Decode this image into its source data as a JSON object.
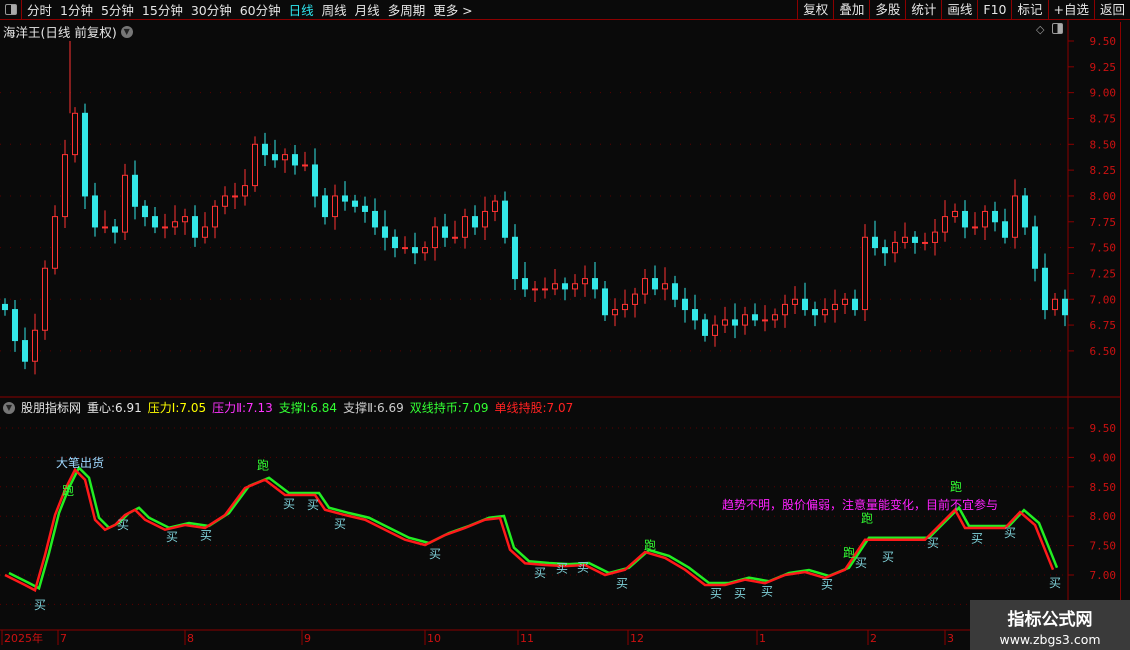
{
  "toolbar": {
    "tabs": [
      "分时",
      "1分钟",
      "5分钟",
      "15分钟",
      "30分钟",
      "60分钟",
      "日线",
      "周线",
      "月线",
      "多周期",
      "更多 >"
    ],
    "active_tab": "日线",
    "right_buttons": [
      "复权",
      "叠加",
      "多股",
      "统计",
      "画线",
      "F10",
      "标记",
      "+自选",
      "返回"
    ]
  },
  "main_chart": {
    "title": "海洋王(日线 前复权)",
    "y_ticks": [
      "9.50",
      "9.25",
      "9.00",
      "8.75",
      "8.50",
      "8.25",
      "8.00",
      "7.75",
      "7.50",
      "7.25",
      "7.00",
      "6.75",
      "6.50"
    ]
  },
  "indicator": {
    "name": "股朋指标网",
    "items": [
      {
        "label": "重心:",
        "value": "6.91",
        "color": "#e6e6e6"
      },
      {
        "label": "压力Ⅰ:",
        "value": "7.05",
        "color": "#ffff00"
      },
      {
        "label": "压力Ⅱ:",
        "value": "7.13",
        "color": "#ff33ff"
      },
      {
        "label": "支撑Ⅰ:",
        "value": "6.84",
        "color": "#33ff33"
      },
      {
        "label": "支撑Ⅱ:",
        "value": "6.69",
        "color": "#cccccc"
      },
      {
        "label": "双线持币:",
        "value": "7.09",
        "color": "#33ff33"
      },
      {
        "label": "单线持股:",
        "value": "7.07",
        "color": "#ff2222"
      }
    ],
    "y_ticks": [
      "9.50",
      "9.00",
      "8.50",
      "8.00",
      "7.50",
      "7.00"
    ],
    "note": "趋势不明，股价偏弱，注意量能变化，目前不宜参与",
    "big_sell": "大笔出货",
    "buy": "买",
    "run": "跑"
  },
  "date_axis": [
    "2025年",
    "7",
    "8",
    "9",
    "10",
    "11",
    "12",
    "1",
    "2",
    "3"
  ],
  "watermark": {
    "name": "指标公式网",
    "url": "www.zbgs3.com"
  },
  "colors": {
    "up": "#ff3333",
    "down": "#33e6e6",
    "line_red": "#ff1a1a",
    "line_green": "#22ee22",
    "grid": "#8b0000",
    "axis_text": "#cc1111"
  },
  "chart_data": [
    {
      "type": "candlestick",
      "title": "海洋王(日线 前复权)",
      "ylim": [
        6.3,
        9.6
      ],
      "close": [
        6.9,
        6.6,
        6.4,
        6.7,
        7.3,
        7.8,
        8.4,
        8.8,
        8.0,
        7.7,
        7.7,
        7.65,
        8.2,
        7.9,
        7.8,
        7.7,
        7.7,
        7.75,
        7.8,
        7.6,
        7.7,
        7.9,
        8.0,
        8.0,
        8.1,
        8.5,
        8.4,
        8.35,
        8.4,
        8.3,
        8.3,
        8.0,
        7.8,
        8.0,
        7.95,
        7.9,
        7.85,
        7.7,
        7.6,
        7.5,
        7.5,
        7.45,
        7.5,
        7.7,
        7.6,
        7.6,
        7.8,
        7.7,
        7.85,
        7.95,
        7.6,
        7.2,
        7.1,
        7.1,
        7.1,
        7.15,
        7.1,
        7.15,
        7.2,
        7.1,
        6.85,
        6.9,
        6.95,
        7.05,
        7.2,
        7.1,
        7.15,
        7.0,
        6.9,
        6.8,
        6.65,
        6.75,
        6.8,
        6.75,
        6.85,
        6.8,
        6.8,
        6.85,
        6.95,
        7.0,
        6.9,
        6.85,
        6.9,
        6.95,
        7.0,
        6.9,
        7.6,
        7.5,
        7.45,
        7.55,
        7.6,
        7.55,
        7.55,
        7.65,
        7.8,
        7.85,
        7.7,
        7.7,
        7.85,
        7.75,
        7.6,
        8.0,
        7.7,
        7.3,
        6.9,
        7.0,
        6.85
      ],
      "high_marks": [
        {
          "bar": 7,
          "value": 9.5
        }
      ]
    },
    {
      "type": "line",
      "ylim": [
        6.55,
        9.85
      ],
      "red_line": [
        [
          0,
          7.0
        ],
        [
          2,
          6.83
        ],
        [
          3,
          6.74
        ],
        [
          4,
          7.34
        ],
        [
          5,
          8.02
        ],
        [
          6,
          8.45
        ],
        [
          7,
          8.79
        ],
        [
          8,
          8.62
        ],
        [
          9,
          7.94
        ],
        [
          10,
          7.77
        ],
        [
          11,
          7.85
        ],
        [
          12,
          8.02
        ],
        [
          13,
          8.11
        ],
        [
          14,
          7.94
        ],
        [
          16,
          7.77
        ],
        [
          18,
          7.85
        ],
        [
          20,
          7.8
        ],
        [
          22,
          8.02
        ],
        [
          24,
          8.48
        ],
        [
          26,
          8.62
        ],
        [
          28,
          8.36
        ],
        [
          30,
          8.36
        ],
        [
          31,
          8.36
        ],
        [
          32,
          8.11
        ],
        [
          34,
          8.02
        ],
        [
          36,
          7.94
        ],
        [
          38,
          7.77
        ],
        [
          40,
          7.6
        ],
        [
          42,
          7.51
        ],
        [
          44,
          7.68
        ],
        [
          46,
          7.8
        ],
        [
          48,
          7.94
        ],
        [
          49.5,
          7.97
        ],
        [
          50.5,
          7.43
        ],
        [
          52,
          7.2
        ],
        [
          54,
          7.17
        ],
        [
          56,
          7.15
        ],
        [
          58,
          7.17
        ],
        [
          60,
          7.0
        ],
        [
          62,
          7.09
        ],
        [
          64,
          7.39
        ],
        [
          66,
          7.29
        ],
        [
          68,
          7.09
        ],
        [
          70,
          6.83
        ],
        [
          72,
          6.83
        ],
        [
          74,
          6.92
        ],
        [
          76,
          6.86
        ],
        [
          78,
          7.0
        ],
        [
          80,
          7.05
        ],
        [
          82,
          6.95
        ],
        [
          84,
          7.09
        ],
        [
          86,
          7.6
        ],
        [
          88,
          7.6
        ],
        [
          90,
          7.6
        ],
        [
          92,
          7.6
        ],
        [
          94,
          7.94
        ],
        [
          95,
          8.11
        ],
        [
          96,
          7.8
        ],
        [
          98,
          7.8
        ],
        [
          100,
          7.8
        ],
        [
          101.5,
          8.07
        ],
        [
          103,
          7.85
        ],
        [
          104.8,
          7.09
        ]
      ],
      "markers": [
        {
          "label": "买",
          "bar": 3.5,
          "value": 6.42
        },
        {
          "label": "买",
          "bar": 11.8,
          "value": 7.78
        },
        {
          "label": "买",
          "bar": 16.7,
          "value": 7.58
        },
        {
          "label": "买",
          "bar": 20.1,
          "value": 7.6
        },
        {
          "label": "买",
          "bar": 28.4,
          "value": 8.14
        },
        {
          "label": "买",
          "bar": 30.8,
          "value": 8.12
        },
        {
          "label": "买",
          "bar": 33.5,
          "value": 7.8
        },
        {
          "label": "买",
          "bar": 43,
          "value": 7.29
        },
        {
          "label": "买",
          "bar": 53.5,
          "value": 6.97
        },
        {
          "label": "买",
          "bar": 55.7,
          "value": 7.04
        },
        {
          "label": "买",
          "bar": 57.8,
          "value": 7.06
        },
        {
          "label": "买",
          "bar": 61.7,
          "value": 6.79
        },
        {
          "label": "买",
          "bar": 71.1,
          "value": 6.62
        },
        {
          "label": "买",
          "bar": 73.5,
          "value": 6.62
        },
        {
          "label": "买",
          "bar": 76.2,
          "value": 6.65
        },
        {
          "label": "买",
          "bar": 82.2,
          "value": 6.77
        },
        {
          "label": "买",
          "bar": 85.6,
          "value": 7.14
        },
        {
          "label": "买",
          "bar": 88.3,
          "value": 7.24
        },
        {
          "label": "买",
          "bar": 92.8,
          "value": 7.48
        },
        {
          "label": "买",
          "bar": 97.2,
          "value": 7.55
        },
        {
          "label": "买",
          "bar": 100.5,
          "value": 7.65
        },
        {
          "label": "买",
          "bar": 105,
          "value": 6.8
        },
        {
          "label": "跑",
          "bar": 6.3,
          "value": 8.36
        },
        {
          "label": "跑",
          "bar": 25.8,
          "value": 8.79
        },
        {
          "label": "跑",
          "bar": 64.5,
          "value": 7.43
        },
        {
          "label": "跑",
          "bar": 84.4,
          "value": 7.31
        },
        {
          "label": "跑",
          "bar": 86.2,
          "value": 7.89
        },
        {
          "label": "跑",
          "bar": 95.1,
          "value": 8.43
        },
        {
          "label": "大笔出货",
          "bar": 7.5,
          "value": 8.84
        }
      ]
    }
  ]
}
